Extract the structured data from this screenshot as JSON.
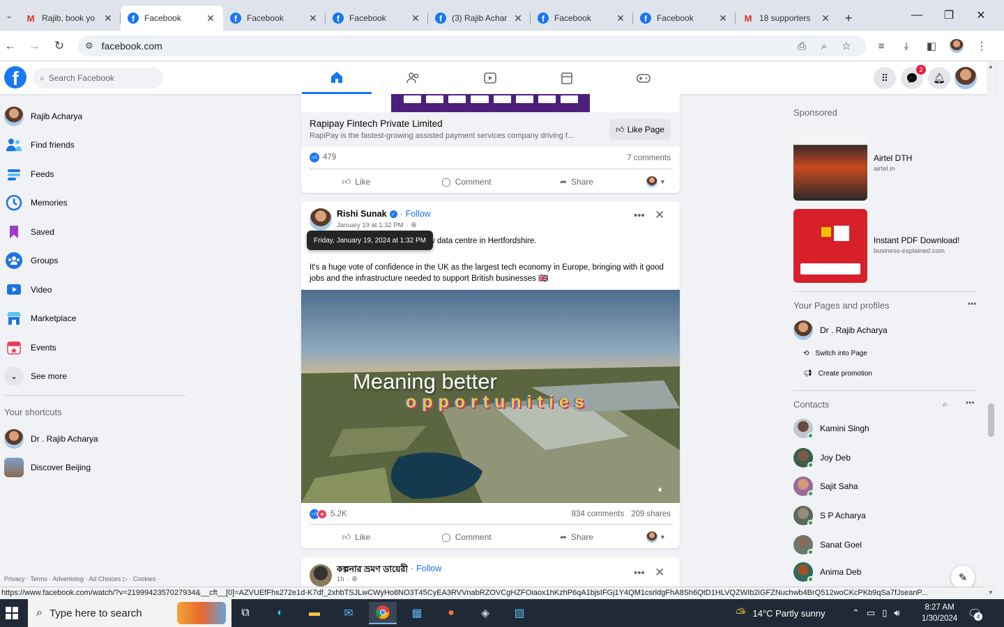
{
  "browser": {
    "tabs": [
      {
        "title": "Rajib, book yo",
        "icon": "gmail",
        "active": false
      },
      {
        "title": "Facebook",
        "icon": "facebook",
        "active": true
      },
      {
        "title": "Facebook",
        "icon": "facebook",
        "active": false
      },
      {
        "title": "Facebook",
        "icon": "facebook",
        "active": false
      },
      {
        "title": "(3) Rajib Achar",
        "icon": "facebook",
        "active": false
      },
      {
        "title": "Facebook",
        "icon": "facebook",
        "active": false
      },
      {
        "title": "Facebook",
        "icon": "facebook",
        "active": false
      },
      {
        "title": "18 supporters",
        "icon": "gmail",
        "active": false
      }
    ],
    "url": "facebook.com",
    "status_url": "https://www.facebook.com/watch/?v=2199942357027934&__cft__[0]=AZVUEfFhs272e1d-K7df_2xhbTSJLwCWyHo8NO3T45CyEA3RVVnabRZOVCgHZFOiaox1hKzhP6qA1bjsIFGj1Y4QM1csrldgFhA8Sh6QtD1HLVQZWIb2iGFZNuchwb4BrQ512woCKcPKb9qSa7fJseanP..."
  },
  "fb": {
    "search_placeholder": "Search Facebook",
    "messenger_badge": "2"
  },
  "left_nav": {
    "items": [
      {
        "label": "Rajib Acharya",
        "icon": "profile-avatar"
      },
      {
        "label": "Find friends",
        "icon": "friends-icon"
      },
      {
        "label": "Feeds",
        "icon": "feeds-icon"
      },
      {
        "label": "Memories",
        "icon": "memories-icon"
      },
      {
        "label": "Saved",
        "icon": "saved-icon"
      },
      {
        "label": "Groups",
        "icon": "groups-icon"
      },
      {
        "label": "Video",
        "icon": "video-icon"
      },
      {
        "label": "Marketplace",
        "icon": "marketplace-icon"
      },
      {
        "label": "Events",
        "icon": "events-icon"
      },
      {
        "label": "See more",
        "icon": "chevron-down-icon"
      }
    ],
    "shortcuts_heading": "Your shortcuts",
    "shortcuts": [
      {
        "label": "Dr . Rajib Acharya"
      },
      {
        "label": "Discover Beijing"
      }
    ],
    "footer": "Privacy · Terms · Advertising · Ad Choices ▷ · Cookies ·"
  },
  "posts": {
    "ad": {
      "page_name": "Rapipay Fintech Private Limited",
      "description": "RapiPay is the fastest-growing assisted payment services company driving f...",
      "like_page_label": "Like Page",
      "reactions": "479",
      "comments": "7 comments"
    },
    "main": {
      "author": "Rishi Sunak",
      "follow": "Follow",
      "time": "January 19 at 1:32 PM",
      "tooltip": "Friday, January 19, 2024 at 1:32 PM",
      "text1": "$1 billion investment to open a new data centre in Hertfordshire.",
      "text2": "It's a huge vote of confidence in the UK as the largest tech economy in Europe, bringing with it good jobs and the infrastructure needed to support British businesses 🇬🇧",
      "video_caption": "Meaning better",
      "video_word": "opportunities",
      "reactions": "5.2K",
      "comments": "834 comments",
      "shares": "209 shares"
    },
    "next": {
      "author": "কল্পনার ভ্রমণ ডায়েরী",
      "follow": "Follow",
      "time": "1h"
    },
    "actions": {
      "like": "Like",
      "comment": "Comment",
      "share": "Share"
    }
  },
  "right_rail": {
    "sponsored_heading": "Sponsored",
    "sponsored": [
      {
        "title": "Airtel DTH",
        "domain": "airtel.in"
      },
      {
        "title": "Instant PDF Download!",
        "domain": "business-explained.com"
      }
    ],
    "pages_heading": "Your Pages and profiles",
    "page_name": "Dr . Rajib Acharya",
    "switch_label": "Switch into Page",
    "promo_label": "Create promotion",
    "contacts_heading": "Contacts",
    "contacts": [
      {
        "name": "Kamini Singh"
      },
      {
        "name": "Joy Deb"
      },
      {
        "name": "Sajit Saha"
      },
      {
        "name": "S P Acharya"
      },
      {
        "name": "Sanat Goel"
      },
      {
        "name": "Anima Deb"
      }
    ]
  },
  "taskbar": {
    "search_placeholder": "Type here to search",
    "weather": "14°C  Partly sunny",
    "time": "8:27 AM",
    "date": "1/30/2024",
    "notif_count": "4"
  },
  "colors": {
    "brand": "#1877f2",
    "online": "#31a24c",
    "badge": "#e41e3f"
  }
}
